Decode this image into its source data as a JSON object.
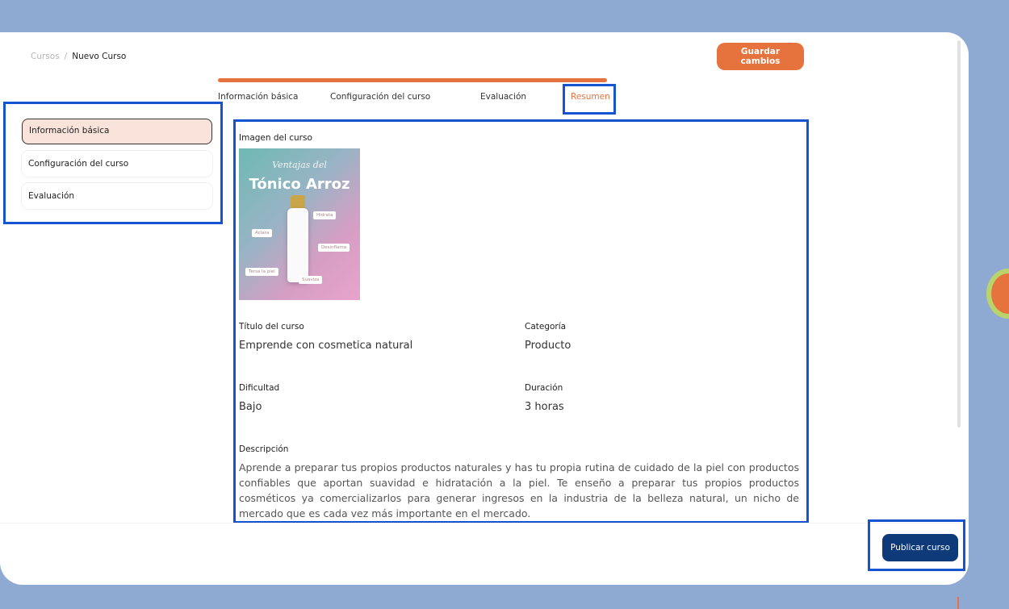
{
  "breadcrumb": {
    "root": "Cursos",
    "separator": "/",
    "current": "Nuevo Curso"
  },
  "header": {
    "save_label": "Guardar cambios"
  },
  "progress": {
    "fraction": 1.0
  },
  "tabs": [
    {
      "label": "Información básica"
    },
    {
      "label": "Configuración del curso"
    },
    {
      "label": "Evaluación"
    },
    {
      "label": "Resumen",
      "active": true
    }
  ],
  "sidebar": {
    "items": [
      {
        "label": "Información básica",
        "active": true
      },
      {
        "label": "Configuración del curso"
      },
      {
        "label": "Evaluación"
      }
    ]
  },
  "summary": {
    "image_label": "Imagen del curso",
    "image": {
      "subtitle": "Ventajas del",
      "title": "Tónico Arroz",
      "tags": [
        "Hidrata",
        "Aclara",
        "Desinflama",
        "Tersa la piel",
        "Suaviza"
      ]
    },
    "title_label": "Título del curso",
    "title_value": "Emprende con cosmetica natural",
    "category_label": "Categoría",
    "category_value": "Producto",
    "difficulty_label": "Dificultad",
    "difficulty_value": "Bajo",
    "duration_label": "Duración",
    "duration_value": "3 horas",
    "description_label": "Descripción",
    "description_value": "Aprende a preparar tus propios productos naturales y has tu propia rutina de cuidado de la piel con productos confiables que aportan suavidad e hidratación a la piel. Te enseño a preparar tus propios productos cosméticos ya comercializarlos para generar ingresos en la industria de la belleza natural, un nicho de mercado que es cada vez más importante en el mercado."
  },
  "footer": {
    "publish_label": "Publicar curso"
  },
  "colors": {
    "accent": "#e6733e",
    "highlight": "#1553d1",
    "publish": "#0e3a7a",
    "background": "#8faad2"
  }
}
